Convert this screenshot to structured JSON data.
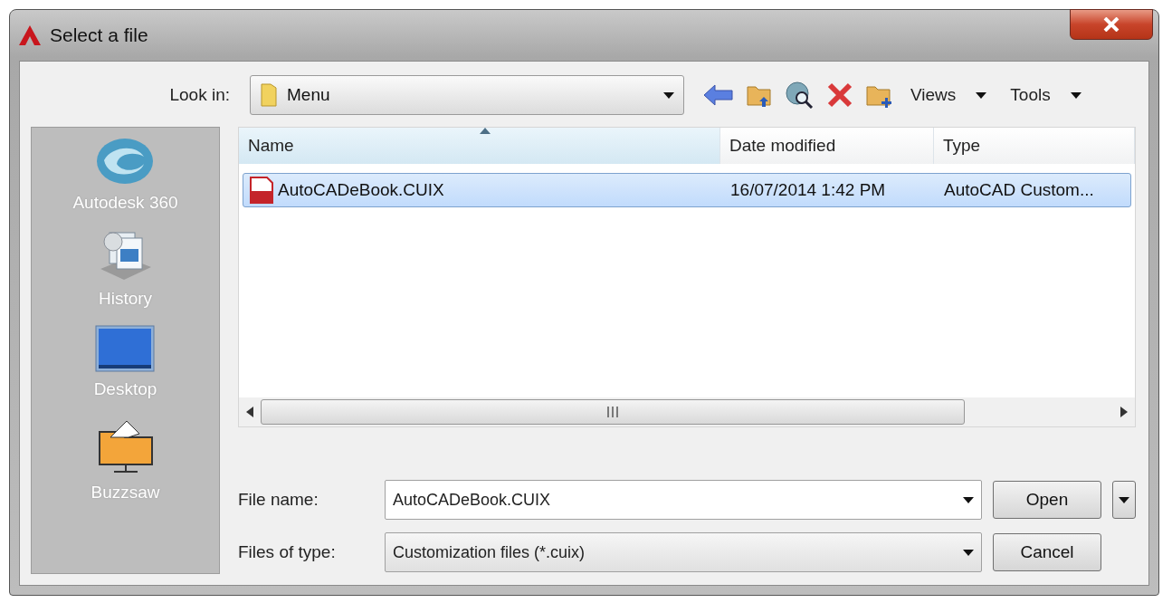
{
  "window": {
    "title": "Select a file"
  },
  "look_in": {
    "label": "Look in:",
    "value": "Menu"
  },
  "toolbar": {
    "menus": [
      {
        "label": "Views"
      },
      {
        "label": "Tools"
      }
    ]
  },
  "places": [
    {
      "label": "Autodesk 360",
      "kind": "cloud"
    },
    {
      "label": "History",
      "kind": "history"
    },
    {
      "label": "Desktop",
      "kind": "desktop"
    },
    {
      "label": "Buzzsaw",
      "kind": "buzzsaw"
    }
  ],
  "table": {
    "columns": [
      {
        "label": "Name",
        "sorted": true
      },
      {
        "label": "Date modified",
        "sorted": false
      },
      {
        "label": "Type",
        "sorted": false
      }
    ],
    "rows": [
      {
        "name": "AutoCADeBook.CUIX",
        "date": "16/07/2014 1:42 PM",
        "type": "AutoCAD Custom...",
        "selected": true
      }
    ]
  },
  "file_name": {
    "label": "File name:",
    "value": "AutoCADeBook.CUIX"
  },
  "file_type": {
    "label": "Files of type:",
    "value": "Customization files (*.cuix)"
  },
  "buttons": [
    {
      "label": "Open"
    },
    {
      "label": "Cancel"
    }
  ]
}
